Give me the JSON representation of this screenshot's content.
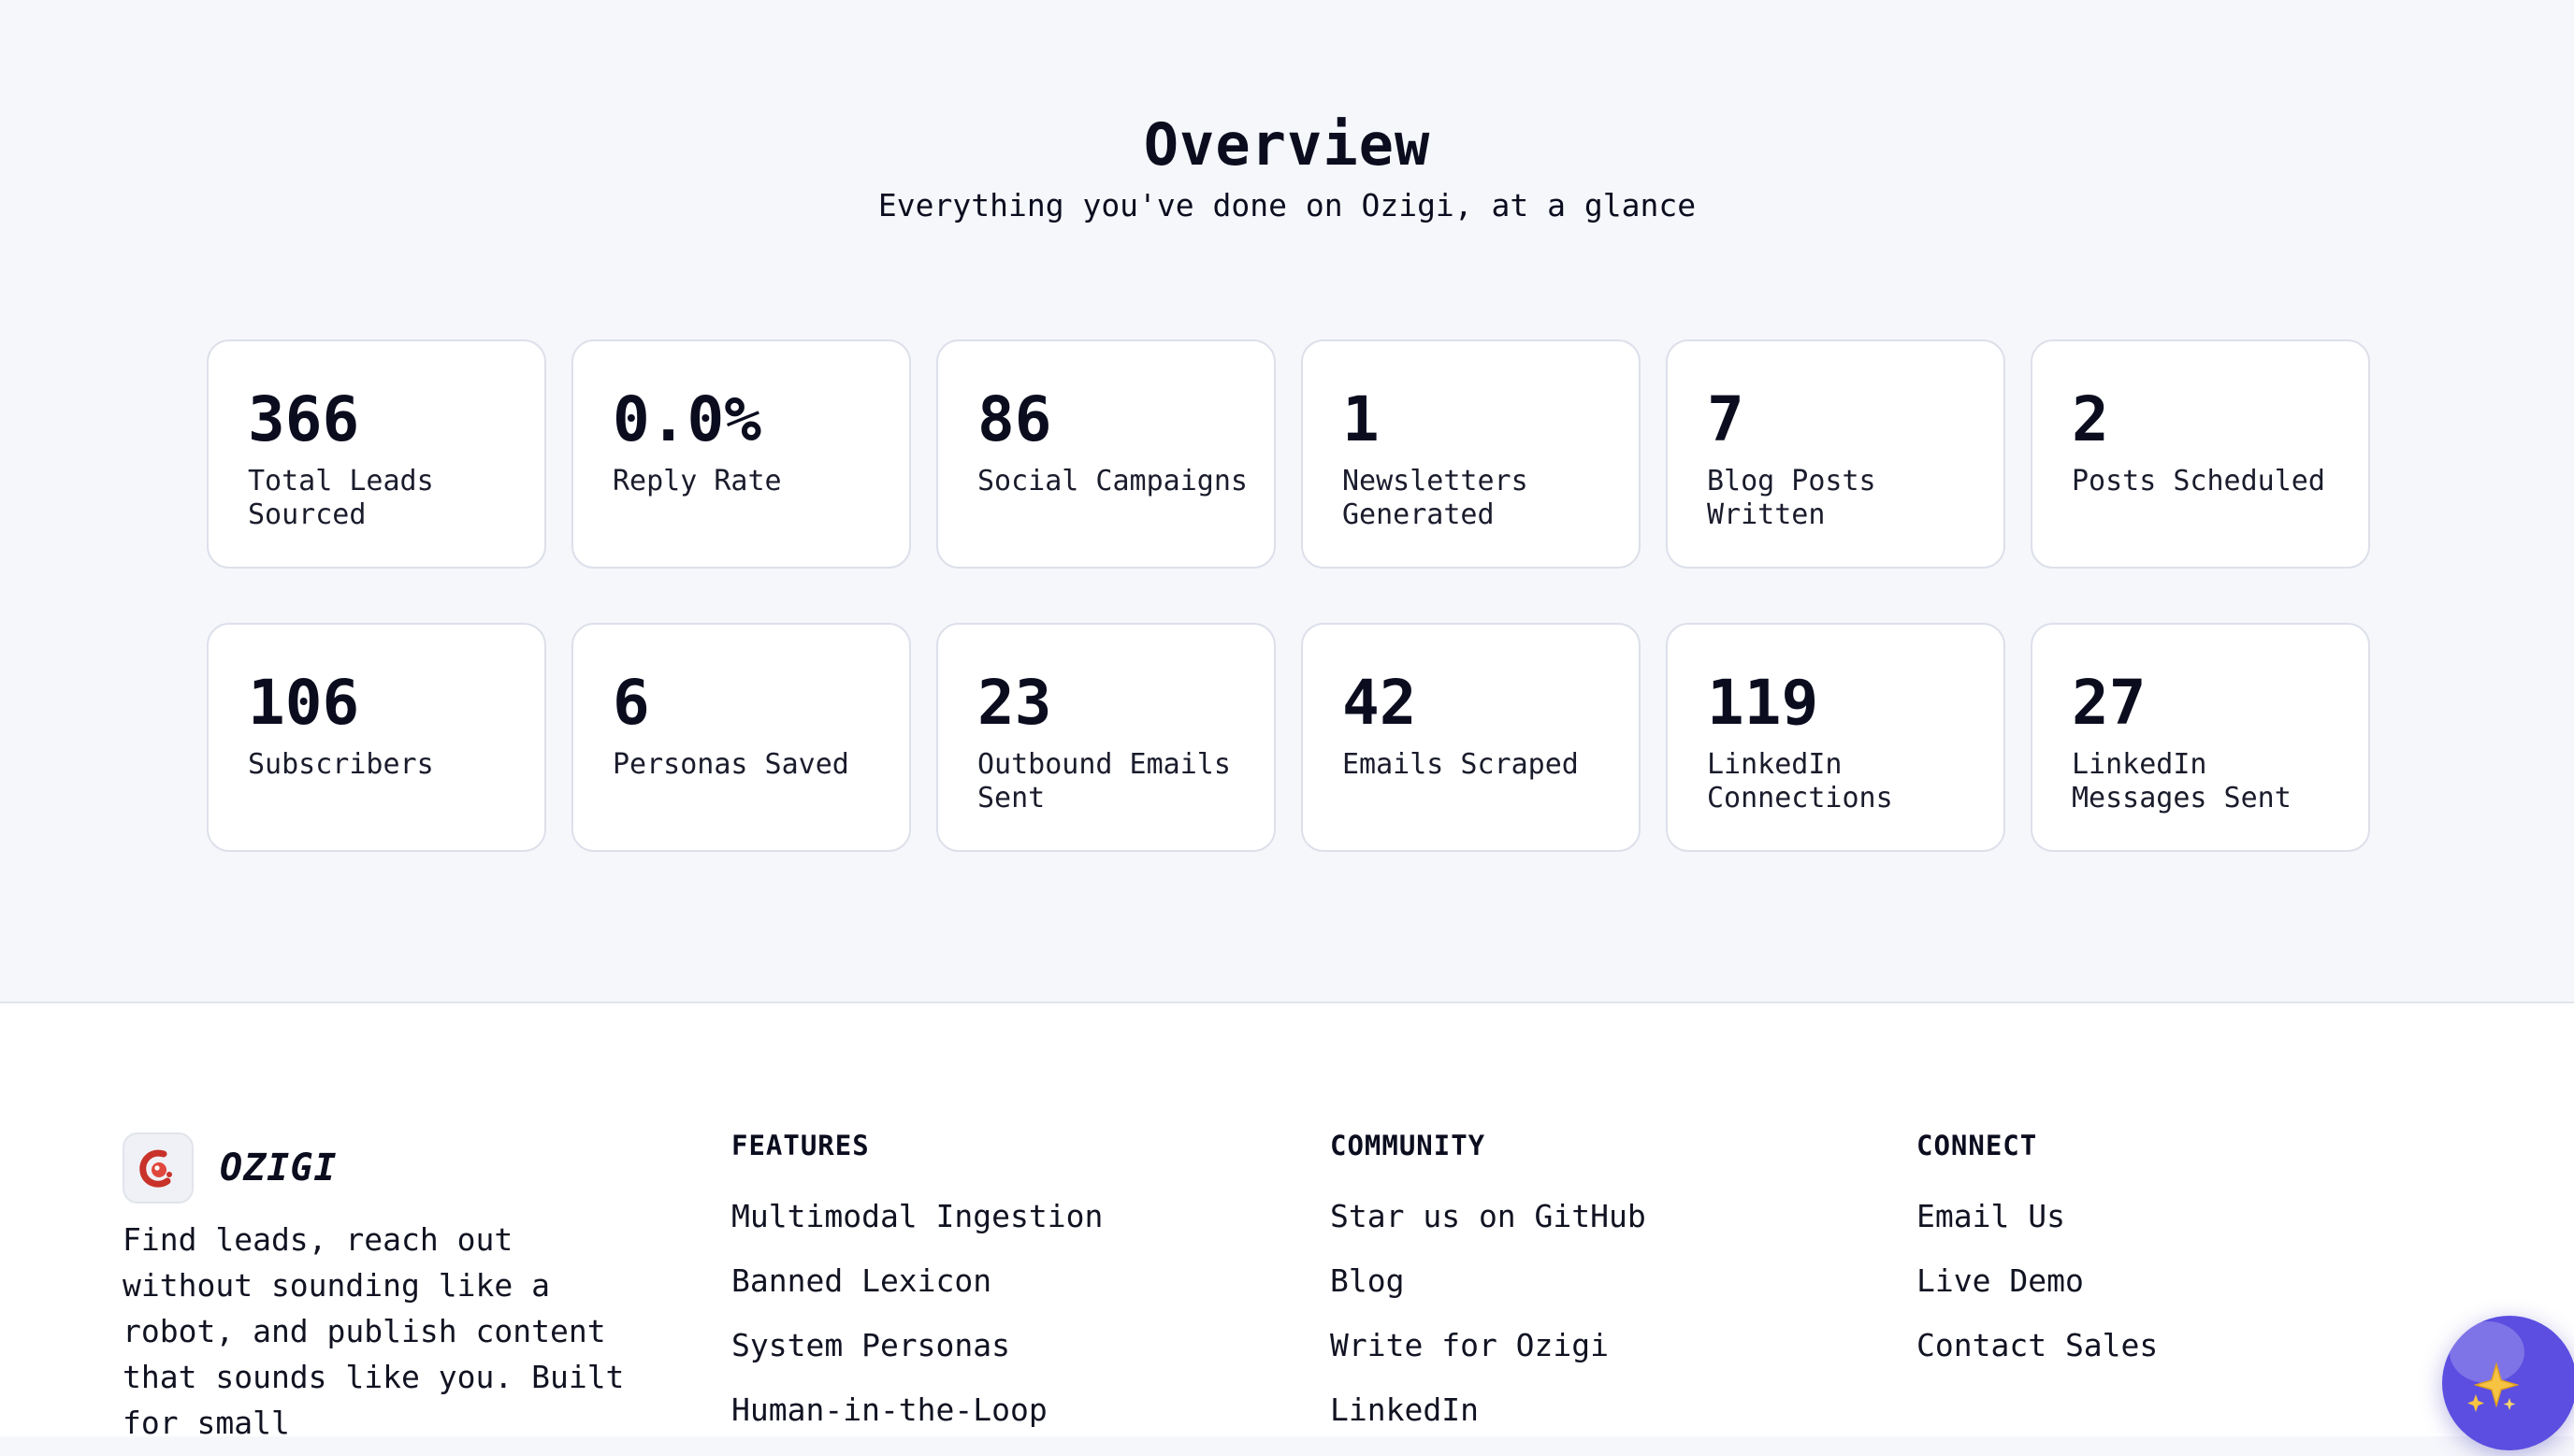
{
  "overview": {
    "title": "Overview",
    "subtitle": "Everything you've done on Ozigi, at a glance"
  },
  "stats": [
    {
      "value": "366",
      "label": "Total Leads Sourced"
    },
    {
      "value": "0.0%",
      "label": "Reply Rate"
    },
    {
      "value": "86",
      "label": "Social Campaigns"
    },
    {
      "value": "1",
      "label": "Newsletters Generated"
    },
    {
      "value": "7",
      "label": "Blog Posts Written"
    },
    {
      "value": "2",
      "label": "Posts Scheduled"
    },
    {
      "value": "106",
      "label": "Subscribers"
    },
    {
      "value": "6",
      "label": "Personas Saved"
    },
    {
      "value": "23",
      "label": "Outbound Emails Sent"
    },
    {
      "value": "42",
      "label": "Emails Scraped"
    },
    {
      "value": "119",
      "label": "LinkedIn Connections"
    },
    {
      "value": "27",
      "label": "LinkedIn Messages Sent"
    }
  ],
  "footer": {
    "brand": {
      "name": "OZIGI",
      "logo_icon": "ozigi-logo-icon",
      "tagline": "Find leads, reach out without sounding like a robot, and publish content that sounds like you. Built for small"
    },
    "features": {
      "heading": "FEATURES",
      "links": [
        "Multimodal Ingestion",
        "Banned Lexicon",
        "System Personas",
        "Human-in-the-Loop"
      ]
    },
    "community": {
      "heading": "COMMUNITY",
      "links": [
        "Star us on GitHub",
        "Blog",
        "Write for Ozigi",
        "LinkedIn"
      ]
    },
    "connect": {
      "heading": "CONNECT",
      "links": [
        "Email Us",
        "Live Demo",
        "Contact Sales"
      ]
    }
  },
  "assistant": {
    "icon": "sparkles-icon"
  },
  "colors": {
    "accent": "#5b4ee0",
    "logo_red": "#c8322a",
    "background": "#f6f7fb"
  }
}
